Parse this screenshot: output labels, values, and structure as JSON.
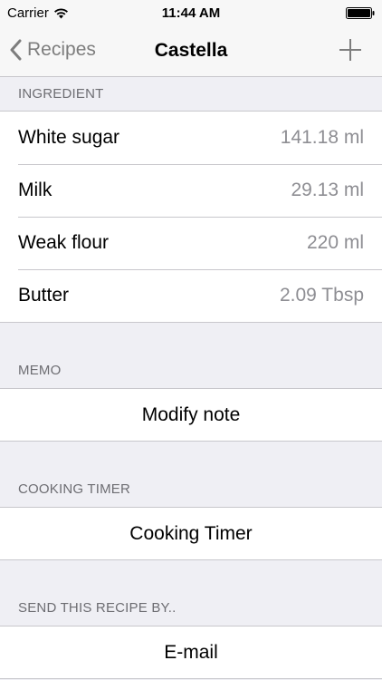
{
  "status_bar": {
    "carrier": "Carrier",
    "time": "11:44 AM"
  },
  "nav": {
    "back_label": "Recipes",
    "title": "Castella",
    "add_icon": "plus-icon"
  },
  "ingredients": {
    "header": "INGREDIENT",
    "items": [
      {
        "name": "White sugar",
        "amount": "141.18 ml"
      },
      {
        "name": "Milk",
        "amount": "29.13 ml"
      },
      {
        "name": "Weak flour",
        "amount": "220 ml"
      },
      {
        "name": "Butter",
        "amount": "2.09 Tbsp"
      }
    ]
  },
  "memo": {
    "header": "MEMO",
    "button": "Modify note"
  },
  "timer": {
    "header": "COOKING TIMER",
    "button": "Cooking Timer"
  },
  "send": {
    "header": "SEND THIS RECIPE BY..",
    "button": "E-mail"
  }
}
